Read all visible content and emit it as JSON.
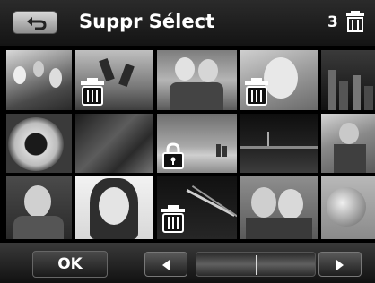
{
  "header": {
    "title": "Suppr Sélect",
    "selected_count": "3"
  },
  "footer": {
    "ok_label": "OK"
  },
  "thumbnails": [
    {
      "name": "thumb-kids-on-grass",
      "overlay": "none"
    },
    {
      "name": "thumb-kids-jumping-sky",
      "overlay": "trash"
    },
    {
      "name": "thumb-two-children",
      "overlay": "none"
    },
    {
      "name": "thumb-baby-portrait",
      "overlay": "trash"
    },
    {
      "name": "thumb-city-skyline-night",
      "overlay": "none"
    },
    {
      "name": "thumb-sunflower",
      "overlay": "none"
    },
    {
      "name": "thumb-leaf-closeup",
      "overlay": "none"
    },
    {
      "name": "thumb-beach-couple",
      "overlay": "lock"
    },
    {
      "name": "thumb-city-lights",
      "overlay": "none"
    },
    {
      "name": "thumb-boy-with-flags",
      "overlay": "none"
    },
    {
      "name": "thumb-woman-smiling",
      "overlay": "none"
    },
    {
      "name": "thumb-girl-portrait",
      "overlay": "none"
    },
    {
      "name": "thumb-highway-lights",
      "overlay": "trash"
    },
    {
      "name": "thumb-smiling-couple",
      "overlay": "none"
    },
    {
      "name": "thumb-round-object",
      "overlay": "none"
    }
  ]
}
